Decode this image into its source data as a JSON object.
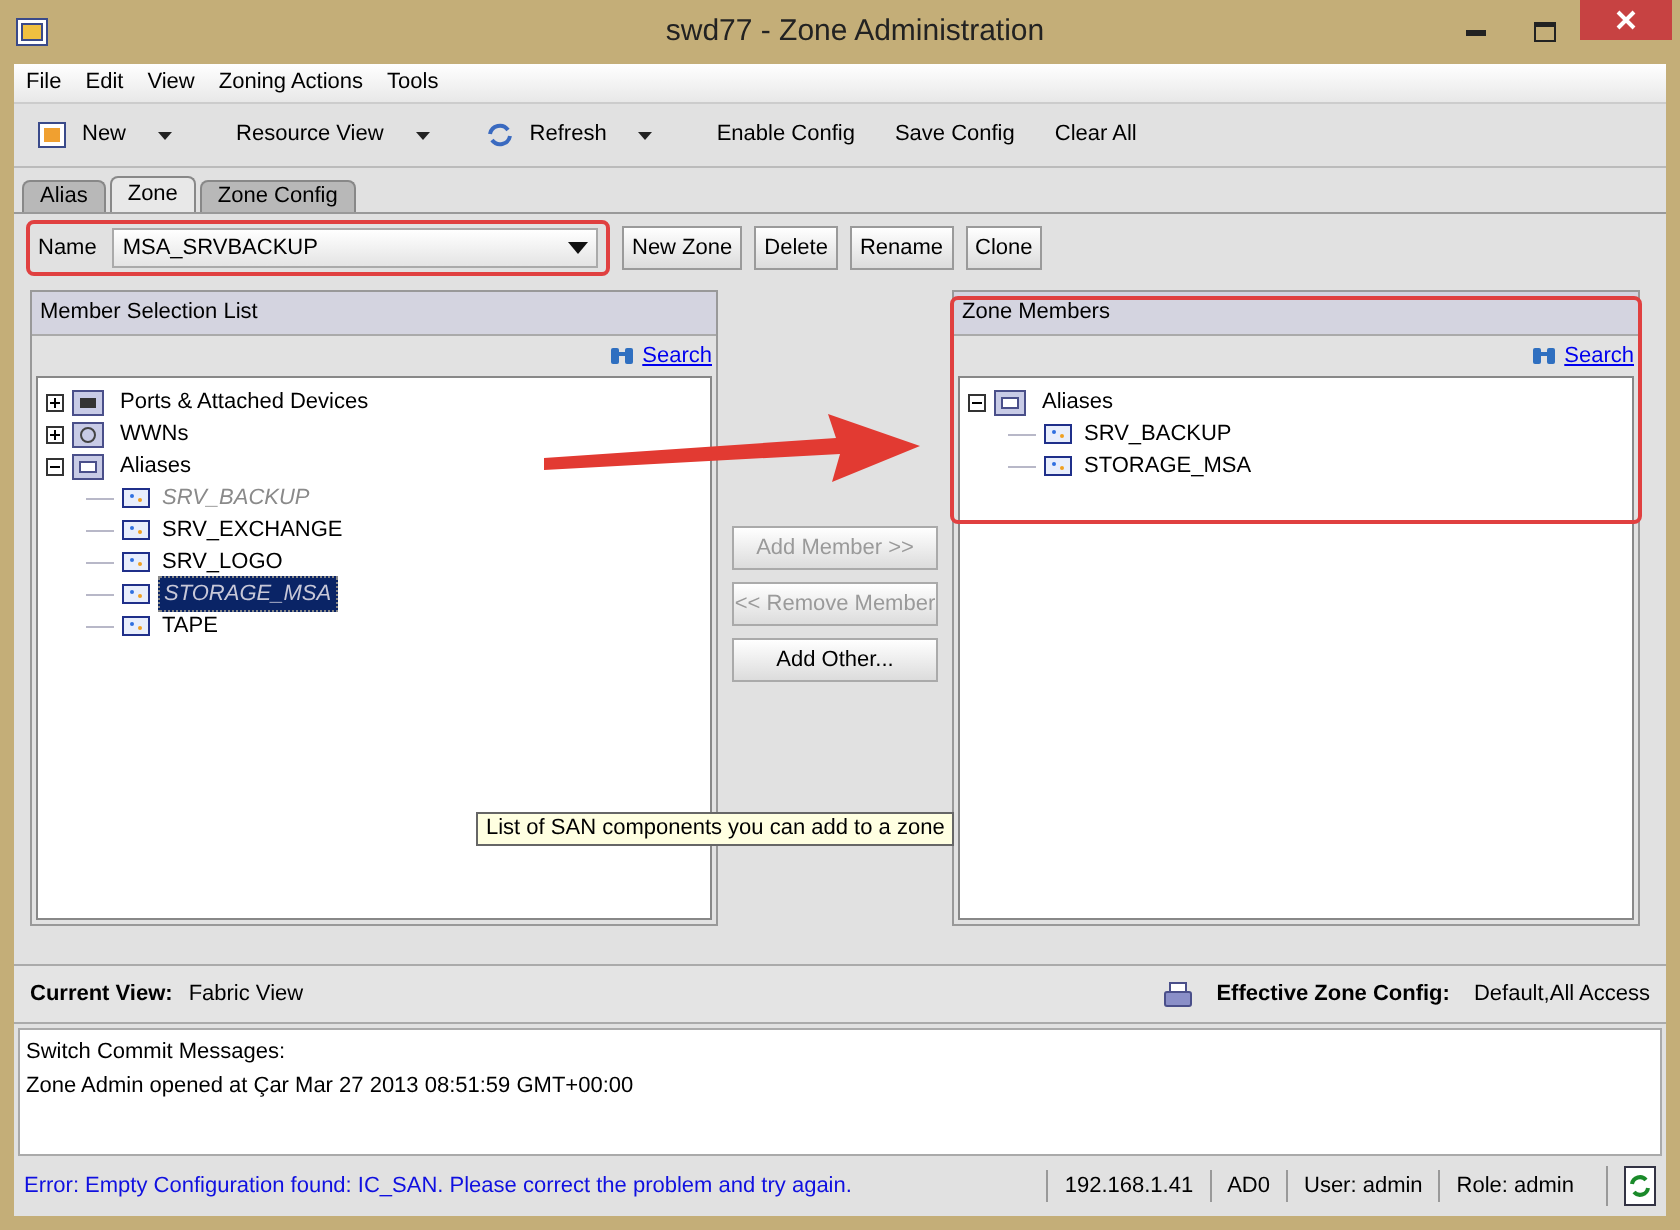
{
  "window": {
    "title": "swd77 - Zone Administration"
  },
  "menu": [
    "File",
    "Edit",
    "View",
    "Zoning Actions",
    "Tools"
  ],
  "toolbar": [
    {
      "label": "New",
      "kind": "dropdown-new"
    },
    {
      "label": "Resource View",
      "kind": "dropdown"
    },
    {
      "label": "Refresh",
      "kind": "dropdown-refresh"
    },
    {
      "label": "Enable Config",
      "kind": "plain"
    },
    {
      "label": "Save Config",
      "kind": "plain"
    },
    {
      "label": "Clear All",
      "kind": "plain"
    }
  ],
  "tabs": [
    {
      "label": "Alias",
      "selected": false
    },
    {
      "label": "Zone",
      "selected": true
    },
    {
      "label": "Zone Config",
      "selected": false
    }
  ],
  "name_field": {
    "label": "Name",
    "value": "MSA_SRVBACKUP"
  },
  "zone_buttons": [
    "New Zone",
    "Delete",
    "Rename",
    "Clone"
  ],
  "member_selection": {
    "title": "Member Selection List",
    "search": "Search",
    "tree": [
      {
        "label": "Ports & Attached Devices",
        "kind": "ports",
        "expanded": false
      },
      {
        "label": "WWNs",
        "kind": "wwn",
        "expanded": false
      },
      {
        "label": "Aliases",
        "kind": "folder",
        "expanded": true,
        "children": [
          {
            "label": "SRV_BACKUP",
            "disabled": true,
            "selected": false
          },
          {
            "label": "SRV_EXCHANGE",
            "disabled": false,
            "selected": false
          },
          {
            "label": "SRV_LOGO",
            "disabled": false,
            "selected": false
          },
          {
            "label": "STORAGE_MSA",
            "disabled": true,
            "selected": true
          },
          {
            "label": "TAPE",
            "disabled": false,
            "selected": false
          }
        ]
      }
    ]
  },
  "action_buttons": [
    {
      "label": "Add Member >>",
      "disabled": true
    },
    {
      "label": "<< Remove Member",
      "disabled": true
    },
    {
      "label": "Add Other...",
      "disabled": false
    }
  ],
  "tooltip": "List of SAN components you can add to a zone",
  "zone_members": {
    "title": "Zone Members",
    "search": "Search",
    "tree": [
      {
        "label": "Aliases",
        "kind": "folder",
        "expanded": true,
        "children": [
          {
            "label": "SRV_BACKUP",
            "disabled": false,
            "selected": false
          },
          {
            "label": "STORAGE_MSA",
            "disabled": false,
            "selected": false
          }
        ]
      }
    ]
  },
  "info_bar": {
    "current_view_label": "Current View:",
    "current_view": "Fabric View",
    "effective_label": "Effective Zone Config:",
    "effective": "Default,All Access"
  },
  "messages": [
    "Switch Commit Messages:",
    "Zone Admin opened at Çar Mar 27 2013 08:51:59 GMT+00:00"
  ],
  "status_bar": {
    "error": "Error: Empty Configuration found: IC_SAN. Please correct the problem and try again.",
    "fields": [
      "192.168.1.41",
      "AD0",
      "User: admin",
      "Role: admin"
    ]
  }
}
